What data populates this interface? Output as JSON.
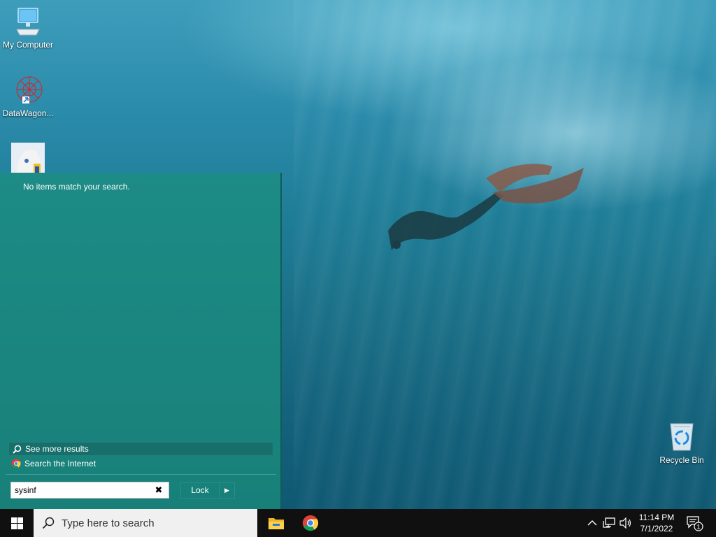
{
  "desktop": {
    "icons": [
      {
        "label": "My Computer",
        "icon": "monitor-icon"
      },
      {
        "label": "DataWagon...",
        "icon": "datawagon-icon"
      },
      {
        "label": "",
        "icon": "anime-app-icon"
      },
      {
        "label": "Recycle Bin",
        "icon": "recycle-bin-icon"
      }
    ]
  },
  "start_panel": {
    "no_items_text": "No items match your search.",
    "see_more_label": "See more results",
    "search_internet_label": "Search the Internet",
    "search_value": "sysinf",
    "clear_glyph": "✖",
    "lock_label": "Lock",
    "lock_arrow_glyph": "▶"
  },
  "taskbar": {
    "search_placeholder": "Type here to search",
    "apps": [
      "file-explorer-icon",
      "chrome-icon"
    ],
    "time": "11:14 PM",
    "date": "7/1/2022",
    "notification_count": "1",
    "tray_icons": [
      "chevron-up-icon",
      "network-icon",
      "volume-icon"
    ]
  },
  "colors": {
    "panel_bg": "#1a8580",
    "taskbar_bg": "#101010",
    "start_logo": "#ffffff"
  }
}
